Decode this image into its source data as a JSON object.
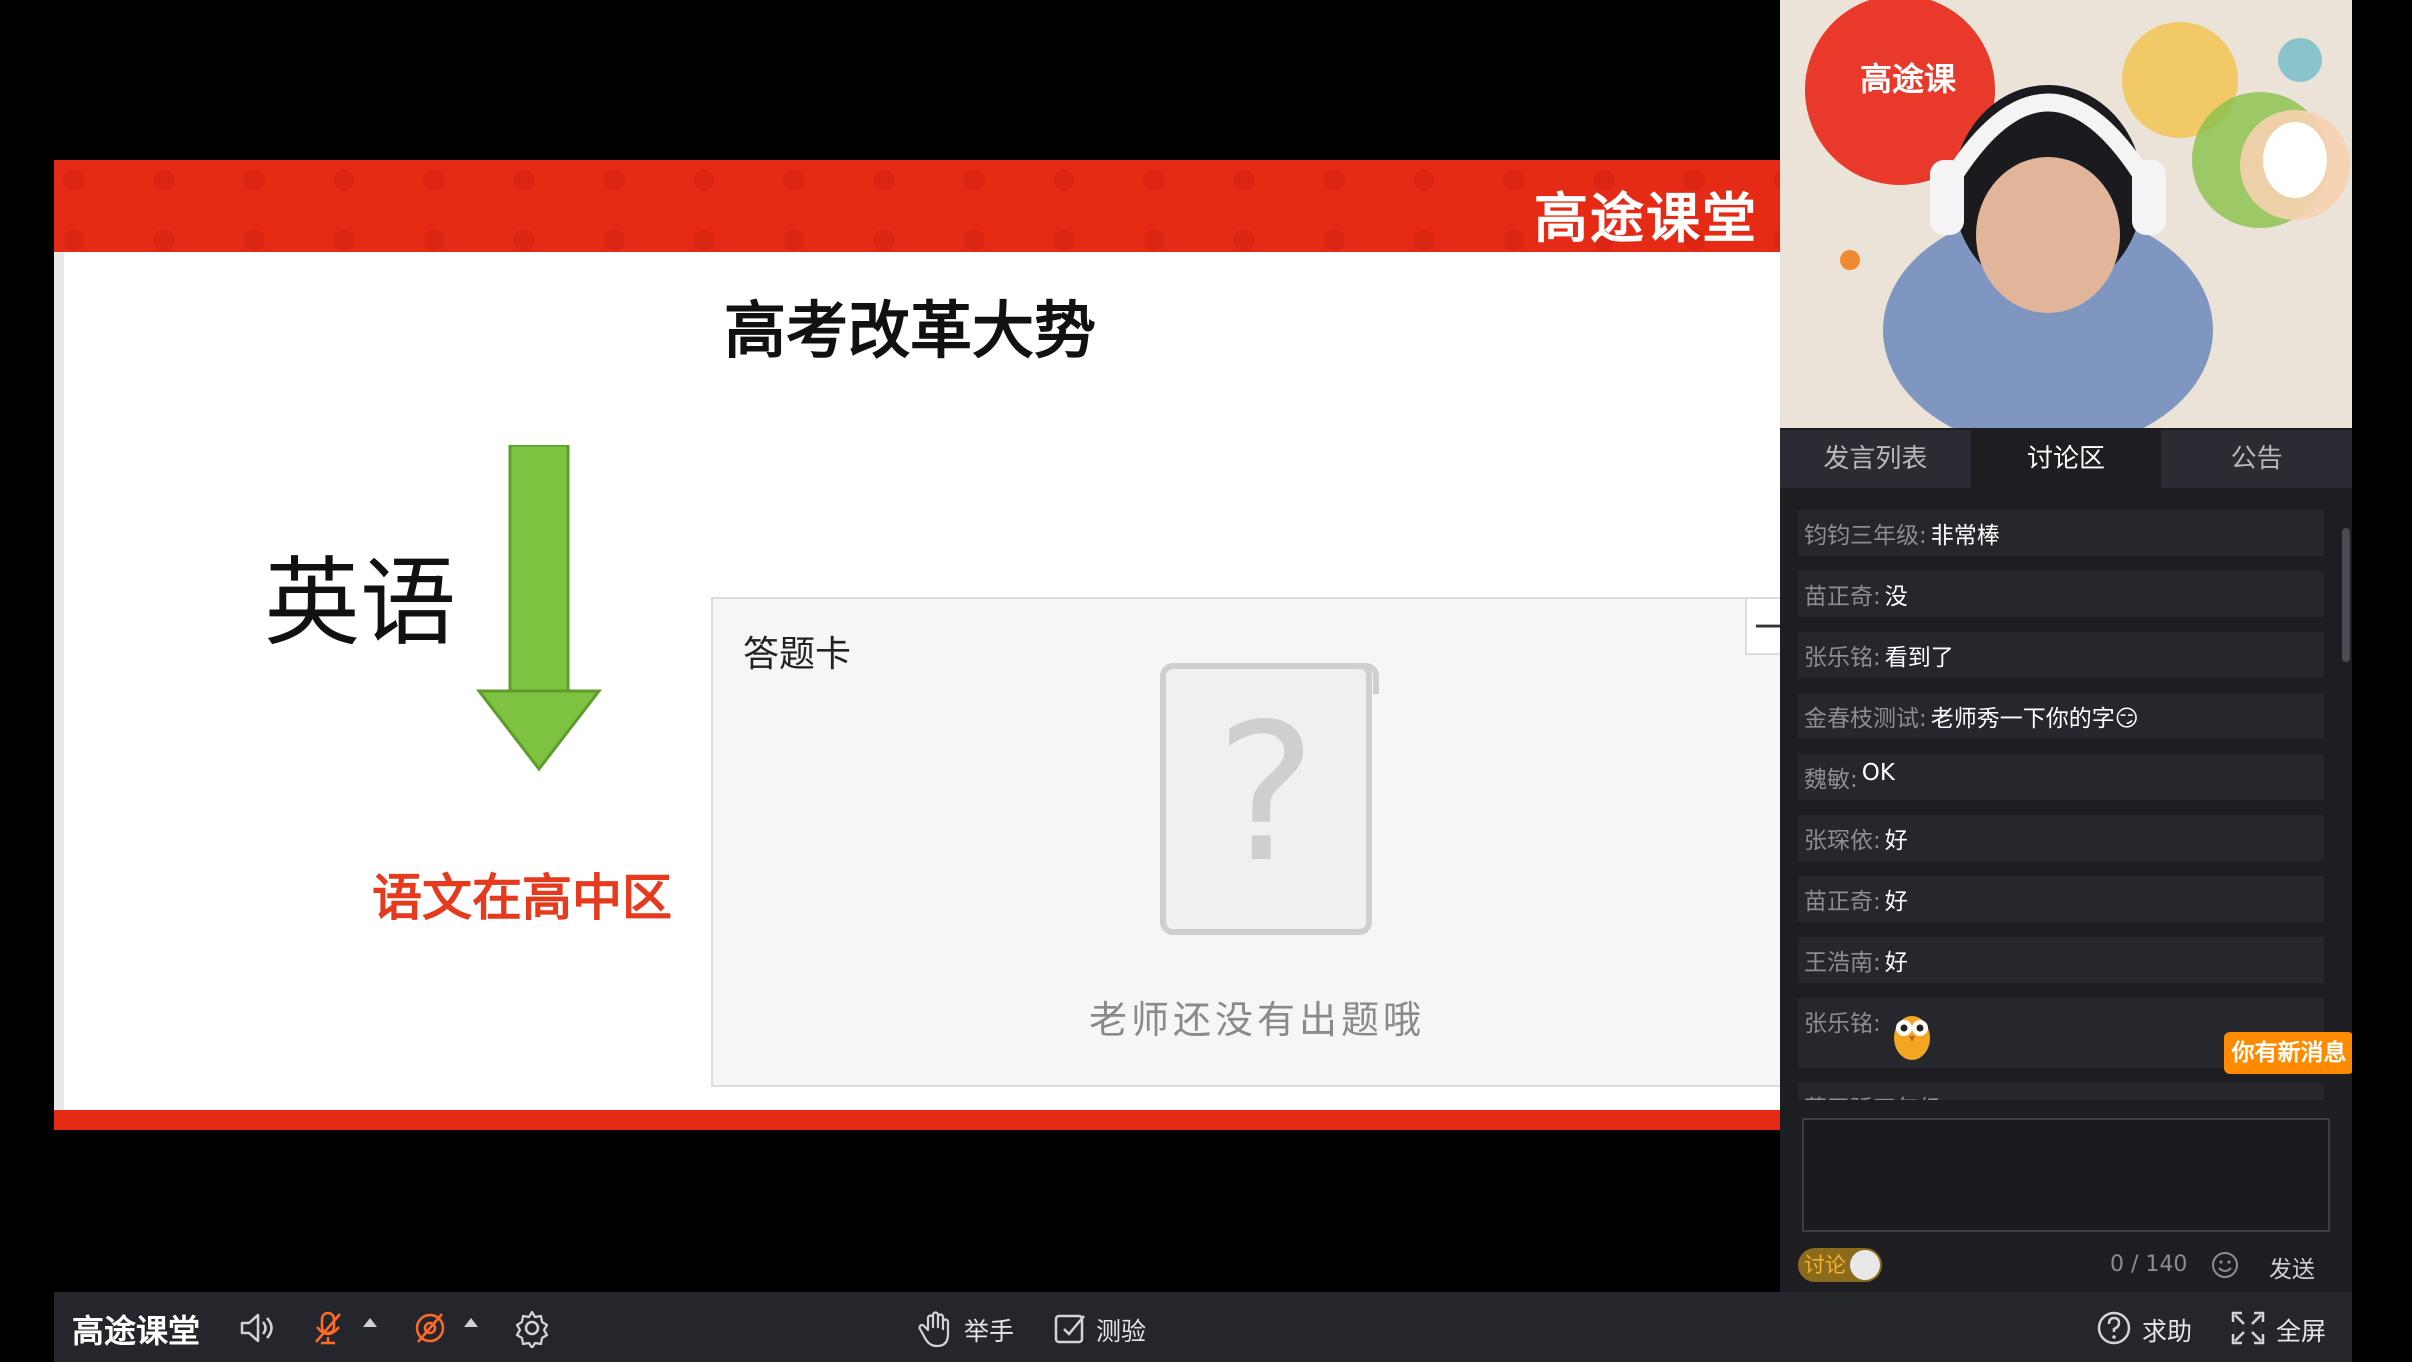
{
  "slide": {
    "brand": "高途课堂",
    "title": "高考改革大势",
    "word": "英语",
    "red_text": "语文在高中区"
  },
  "answer_card": {
    "title": "答题卡",
    "minimize": "—",
    "empty_message": "老师还没有出题哦"
  },
  "video": {
    "brand_text": "高途课"
  },
  "tabs": [
    {
      "label": "发言列表"
    },
    {
      "label": "讨论区"
    },
    {
      "label": "公告"
    }
  ],
  "active_tab": "讨论区",
  "messages": [
    {
      "name": "钧钧三年级:",
      "text": "非常棒"
    },
    {
      "name": "苗正奇:",
      "text": "没"
    },
    {
      "name": "张乐铭:",
      "text": "看到了"
    },
    {
      "name": "金春枝测试:",
      "text": "老师秀一下你的字😏"
    },
    {
      "name": "魏敏:",
      "text": "OK"
    },
    {
      "name": "张琛依:",
      "text": "好"
    },
    {
      "name": "苗正奇:",
      "text": "好"
    },
    {
      "name": "王浩南:",
      "text": "好"
    },
    {
      "name": "张乐铭:",
      "text": ""
    },
    {
      "name": "蔡天骄四年级:",
      "text": ""
    }
  ],
  "new_message_badge": "你有新消息",
  "composer": {
    "toggle_label": "讨论",
    "counter": "0 / 140",
    "send_label": "发送"
  },
  "bottombar": {
    "brand": "高途课堂",
    "raise_hand": "举手",
    "quiz": "测验",
    "help": "求助",
    "fullscreen": "全屏"
  },
  "colors": {
    "accent_red": "#e52a16",
    "mic_orange": "#ff6a2a",
    "badge_orange": "#ff8a00"
  }
}
